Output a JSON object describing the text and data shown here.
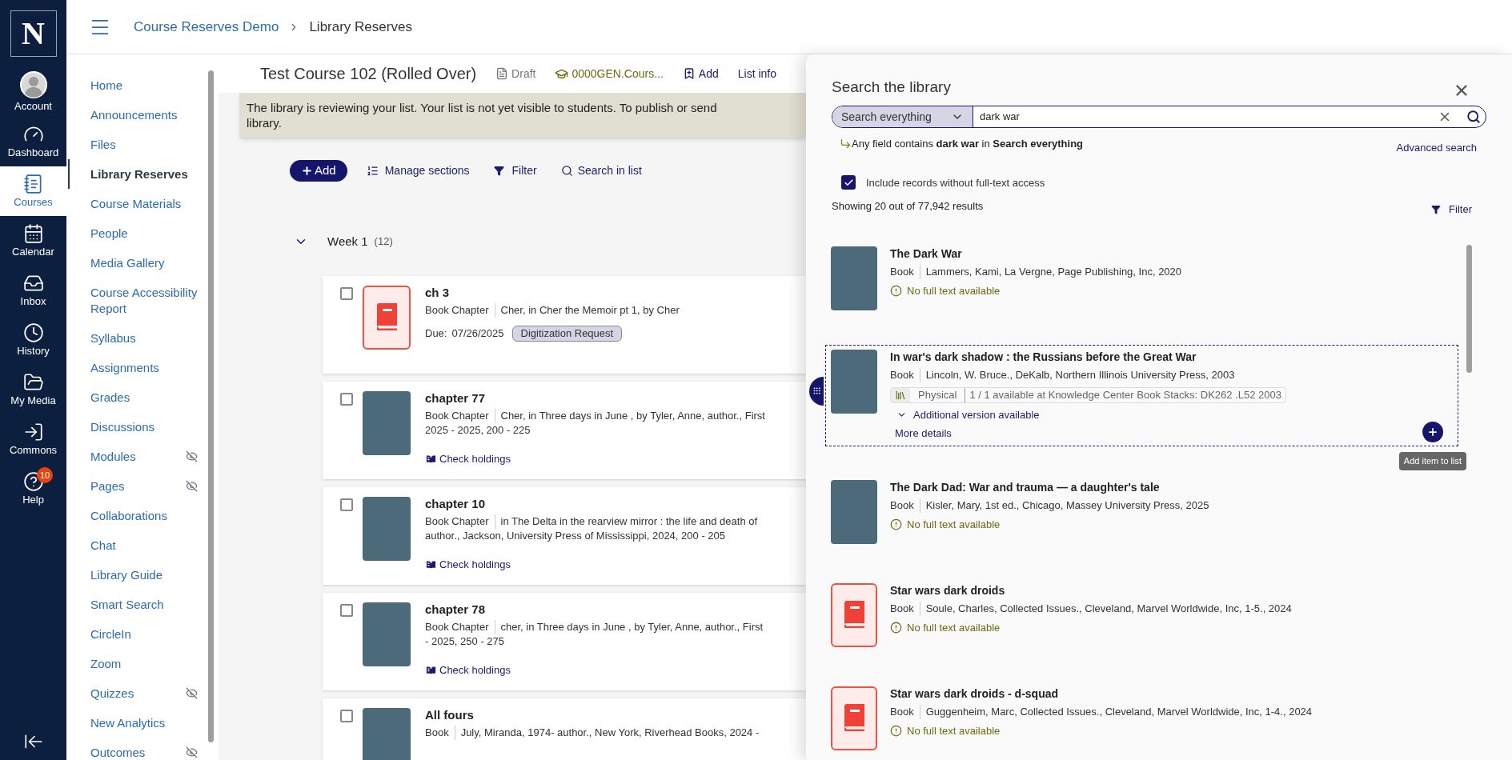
{
  "rail": {
    "logo": "N",
    "items": [
      {
        "label": "Account",
        "selected": false
      },
      {
        "label": "Dashboard",
        "selected": false
      },
      {
        "label": "Courses",
        "selected": true
      },
      {
        "label": "Calendar",
        "selected": false
      },
      {
        "label": "Inbox",
        "selected": false
      },
      {
        "label": "History",
        "selected": false
      },
      {
        "label": "My Media",
        "selected": false
      },
      {
        "label": "Commons",
        "selected": false
      },
      {
        "label": "Help",
        "selected": false,
        "badge": "10"
      }
    ]
  },
  "breadcrumb": [
    "Course Reserves Demo",
    "Library Reserves"
  ],
  "course_nav": [
    {
      "label": "Home",
      "selected": false,
      "hidden": false
    },
    {
      "label": "Announcements",
      "selected": false,
      "hidden": false
    },
    {
      "label": "Files",
      "selected": false,
      "hidden": false
    },
    {
      "label": "Library Reserves",
      "selected": true,
      "hidden": false
    },
    {
      "label": "Course Materials",
      "selected": false,
      "hidden": false
    },
    {
      "label": "People",
      "selected": false,
      "hidden": false
    },
    {
      "label": "Media Gallery",
      "selected": false,
      "hidden": false
    },
    {
      "label": "Course Accessibility Report",
      "selected": false,
      "hidden": false
    },
    {
      "label": "Syllabus",
      "selected": false,
      "hidden": false
    },
    {
      "label": "Assignments",
      "selected": false,
      "hidden": false
    },
    {
      "label": "Grades",
      "selected": false,
      "hidden": false
    },
    {
      "label": "Discussions",
      "selected": false,
      "hidden": false
    },
    {
      "label": "Modules",
      "selected": false,
      "hidden": true
    },
    {
      "label": "Pages",
      "selected": false,
      "hidden": true
    },
    {
      "label": "Collaborations",
      "selected": false,
      "hidden": false
    },
    {
      "label": "Chat",
      "selected": false,
      "hidden": false
    },
    {
      "label": "Library Guide",
      "selected": false,
      "hidden": false
    },
    {
      "label": "Smart Search",
      "selected": false,
      "hidden": false
    },
    {
      "label": "CircleIn",
      "selected": false,
      "hidden": false
    },
    {
      "label": "Zoom",
      "selected": false,
      "hidden": false
    },
    {
      "label": "Quizzes",
      "selected": false,
      "hidden": true
    },
    {
      "label": "New Analytics",
      "selected": false,
      "hidden": false
    },
    {
      "label": "Outcomes",
      "selected": false,
      "hidden": true
    }
  ],
  "list": {
    "title": "Test Course 102 (Rolled Over)",
    "status": "Draft",
    "course_code": "0000GEN.Cours...",
    "add": "Add",
    "list_info": "List info",
    "banner": [
      "The library is reviewing your list. Your list is not yet visible to students. To publish or send",
      "library."
    ],
    "toolbar": {
      "add": "Add",
      "manage_sections": "Manage sections",
      "filter": "Filter",
      "search": "Search in list"
    },
    "section": {
      "title": "Week 1",
      "count": "(12)",
      "expanded": true
    },
    "items": [
      {
        "title": "ch 3",
        "type": "Book Chapter",
        "kind": "placeholder",
        "checked": false,
        "meta": [
          "Cher, in Cher the Memoir pt 1, by Cher"
        ],
        "due_label": "Due:",
        "due": "07/26/2025",
        "tag": "Digitization Request"
      },
      {
        "title": "chapter 77",
        "type": "Book Chapter",
        "kind": "photo",
        "checked": false,
        "meta": [
          "Cher, in Three days in June , by Tyler, Anne, author., First",
          "2025 - 2025, 200 - 225"
        ],
        "link": "Check holdings"
      },
      {
        "title": "chapter 10",
        "type": "Book Chapter",
        "kind": "photo",
        "checked": false,
        "meta": [
          "in The Delta in the rearview mirror : the life and death of",
          "author., Jackson, University Press of Mississippi, 2024, 200 - 205"
        ],
        "link": "Check holdings"
      },
      {
        "title": "chapter 78",
        "type": "Book Chapter",
        "kind": "photo",
        "checked": false,
        "meta": [
          "cher, in Three days in June , by Tyler, Anne, author., First",
          "- 2025, 250 - 275"
        ],
        "link": "Check holdings"
      },
      {
        "title": "All fours",
        "type": "Book",
        "kind": "photo",
        "checked": false,
        "meta": [
          "July, Miranda, 1974- author., New York, Riverhead Books, 2024 -"
        ]
      }
    ]
  },
  "drawer": {
    "title": "Search the library",
    "scope": "Search everything",
    "query": "dark war",
    "hint": "Any field contains **dark war** in **Search everything**",
    "advanced": "Advanced search",
    "include": {
      "label": "Include records without full-text access",
      "checked": true
    },
    "count": "Showing 20 out of 77,942 results",
    "filter": "Filter",
    "results": [
      {
        "title": "The Dark War",
        "type": "Book",
        "meta": "Lammers, Kami, La Vergne, Page Publishing, Inc, 2020",
        "kind": "photo",
        "focused": false,
        "availability": {
          "kind": "none",
          "text": "No full text available"
        }
      },
      {
        "title": "In war's dark shadow : the Russians before the Great War",
        "type": "Book",
        "meta": "Lincoln, W. Bruce., DeKalb, Northern Illinois University Press, 2003",
        "kind": "photo",
        "focused": true,
        "availability": {
          "kind": "physical",
          "label": "Physical",
          "text": "1 / 1 available at Knowledge Center Book Stacks: DK262 .L52 2003"
        },
        "additional": "Additional version available",
        "more": "More details",
        "tooltip": "Add item to list"
      },
      {
        "title": "The Dark Dad: War and trauma — a daughter's tale",
        "type": "Book",
        "meta": "Kisler, Mary, 1st ed., Chicago, Massey University Press, 2025",
        "kind": "photo",
        "focused": false,
        "availability": {
          "kind": "none",
          "text": "No full text available"
        }
      },
      {
        "title": "Star wars dark droids",
        "type": "Book",
        "meta": "Soule, Charles, Collected Issues., Cleveland, Marvel Worldwide, Inc, 1-5., 2024",
        "kind": "placeholder",
        "focused": false,
        "availability": {
          "kind": "none",
          "text": "No full text available"
        }
      },
      {
        "title": "Star wars dark droids - d-squad",
        "type": "Book",
        "meta": "Guggenheim, Marc, Collected Issues., Cleveland, Marvel Worldwide, Inc, 1-4., 2024",
        "kind": "placeholder",
        "focused": false,
        "availability": {
          "kind": "none",
          "text": "No full text available"
        }
      }
    ]
  }
}
